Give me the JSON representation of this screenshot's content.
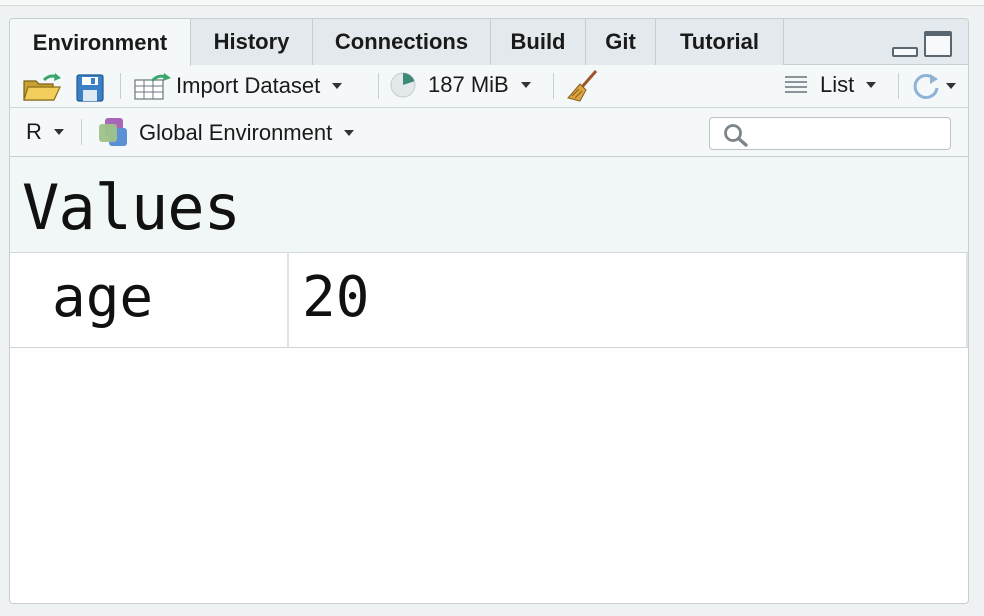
{
  "tabs": [
    {
      "label": "Environment",
      "active": true
    },
    {
      "label": "History",
      "active": false
    },
    {
      "label": "Connections",
      "active": false
    },
    {
      "label": "Build",
      "active": false
    },
    {
      "label": "Git",
      "active": false
    },
    {
      "label": "Tutorial",
      "active": false
    }
  ],
  "toolbar": {
    "import_label": "Import Dataset",
    "memory_label": "187 MiB",
    "view_label": "List"
  },
  "toolbar2": {
    "language_label": "R",
    "environment_label": "Global Environment",
    "search_placeholder": ""
  },
  "section": {
    "title": "Values"
  },
  "variables": [
    {
      "name": "age",
      "value": "20"
    }
  ],
  "colors": {
    "accent_green": "#3aa66b",
    "folder_yellow": "#e8b840",
    "save_blue": "#3b7fc4"
  }
}
